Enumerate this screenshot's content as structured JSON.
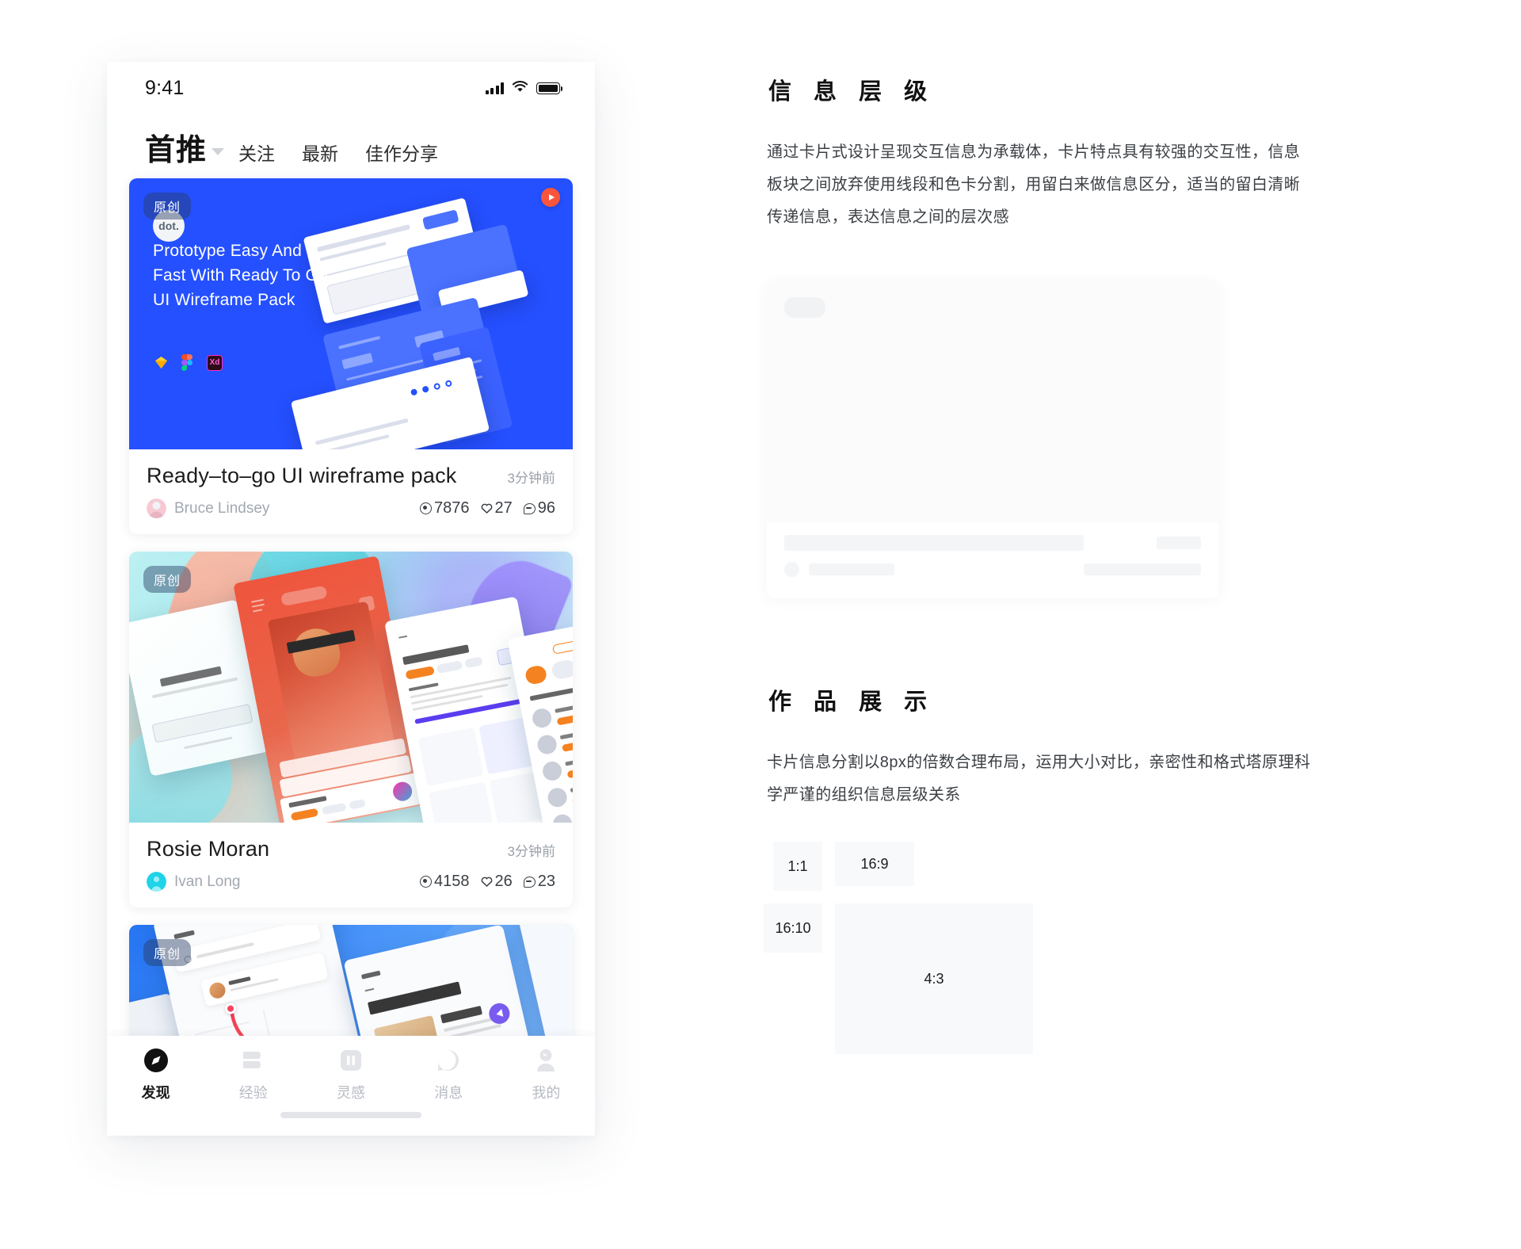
{
  "phone": {
    "status": {
      "time": "9:41",
      "signal_icon": "cellular-signal-icon",
      "wifi_icon": "wifi-icon",
      "battery_icon": "battery-icon"
    },
    "nav": {
      "primary_tab": "首推",
      "caret_icon": "chevron-down-icon",
      "tabs": [
        "关注",
        "最新",
        "佳作分享"
      ]
    },
    "cards": [
      {
        "badge": "原创",
        "avatar_text": "dot.",
        "play_icon": "play-button-icon",
        "headline": "Prototype Easy And Fast With Ready To Go UI Wireframe Pack",
        "tools": [
          "sketch-icon",
          "figma-icon",
          "adobe-xd-icon"
        ],
        "title": "Ready–to–go UI wireframe pack",
        "time": "3分钟前",
        "author": "Bruce Lindsey",
        "views": "7876",
        "likes": "27",
        "comments": "96"
      },
      {
        "badge": "原创",
        "title": "Rosie Moran",
        "time": "3分钟前",
        "author": "Ivan Long",
        "views": "4158",
        "likes": "26",
        "comments": "23"
      },
      {
        "badge": "原创"
      }
    ],
    "tabbar": [
      {
        "label": "发现",
        "icon": "compass-icon",
        "active": true
      },
      {
        "label": "经验",
        "icon": "book-icon",
        "active": false
      },
      {
        "label": "灵感",
        "icon": "pause-square-icon",
        "active": false
      },
      {
        "label": "消息",
        "icon": "chat-bubble-icon",
        "active": false
      },
      {
        "label": "我的",
        "icon": "person-icon",
        "active": false
      }
    ]
  },
  "right": {
    "section1": {
      "heading": "信 息 层 级",
      "body": "通过卡片式设计呈现交互信息为承载体，卡片特点具有较强的交互性，信息板块之间放弃使用线段和色卡分割，用留白来做信息区分，适当的留白清晰传递信息，表达信息之间的层次感"
    },
    "section2": {
      "heading": "作 品 展 示",
      "body": "卡片信息分割以8px的倍数合理布局，运用大小对比，亲密性和格式塔原理科学严谨的组织信息层级关系",
      "ratios": [
        {
          "label": "1:1"
        },
        {
          "label": "16:9"
        },
        {
          "label": "16:10"
        },
        {
          "label": "4:3"
        }
      ]
    }
  },
  "colors": {
    "accent_blue": "#2550FF",
    "highlight_yellow": "#F8EE3A",
    "play_red": "#F8553C",
    "text_dark": "#1C1C1C",
    "text_muted": "#A2A8B0"
  }
}
